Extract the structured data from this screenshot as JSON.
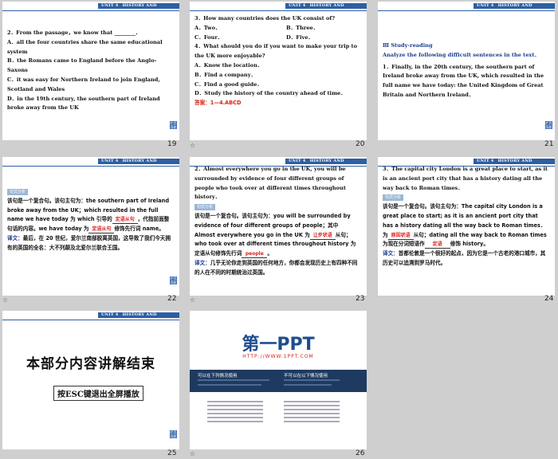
{
  "header": "UNIT 4　HISTORY AND TRADITIONS",
  "corner_label": "栏目导航",
  "s19": {
    "lines": [
      "2．From the passage，we know that ________．",
      "A．all the four countries share the same educational system",
      "B．the Romans came to England before the Anglo-Saxons",
      "C．it was easy for Northern Ireland to join England, Scotland and Wales",
      "D．in the 19th century, the southern part of Ireland broke away from the UK"
    ],
    "num": "19"
  },
  "s20": {
    "q3": "3．How many countries does the UK consist of?",
    "opts1": [
      "A．Two．",
      "B．Three．"
    ],
    "opts2": [
      "C．Four．",
      "D．Five．"
    ],
    "q4": "4．What should you do if you want to make your trip to the UK more enjoyable?",
    "a": "A．Know the location．",
    "b": "B．Find a company．",
    "c": "C．Find a good guide．",
    "d": "D．Study the history of the country ahead of time．",
    "answer": "答案：1—4.ABCD",
    "num": "20"
  },
  "s21": {
    "title": "Ⅲ Study-reading",
    "subtitle": "Analyze the following difficult sentences in the text．",
    "text": "1．Finally, in the 20th century, the southern part of Ireland broke away from the UK, which resulted in the full name we have today: the United Kingdom of Great Britain and Northern Ireland．",
    "num": "21"
  },
  "s22": {
    "tag": "句式分析",
    "p1": "该句是一个复合句。该句主句为：the southern part of Ireland broke away from the UK；which resulted in the full name we have today 为 which 引导的",
    "fill1": "定语从句",
    "p1b": "，代指前面整句话的内容。we have today 为",
    "fill2": "定语从句",
    "p1c": "修饰先行词 name。",
    "trans_label": "译文：",
    "trans": "最后，在 20 世纪，爱尔兰南部脱离英国，这导致了我们今天拥有的英国的全名：大不列颠及北爱尔兰联合王国。",
    "num": "22"
  },
  "s23": {
    "text": "2．Almost everywhere you go in the UK, you will be surrounded by evidence of four different groups of people who took over at different times throughout history．",
    "tag": "句式分析",
    "p1": "该句是一个复合句。该句主句为：you will be surrounded by evidence of four different groups of people；其中 Almost everywhere you go in the UK 为",
    "fill1": "让步状语",
    "p1b": "从句；who took over at different times throughout history 为定语从句修饰先行词",
    "fill2": "people",
    "p1c": "。",
    "trans_label": "译文：",
    "trans": "几乎无论你走到英国的任何地方，你都会发现历史上有四种不同的人在不同的时期统治过英国。",
    "num": "23"
  },
  "s24": {
    "text": "3．The capital city London is a great place to start, as it is an ancient port city that has a history dating all the way back to Roman times．",
    "tag": "句式分析",
    "p1": "该句是一个复合句。该句主句为：The capital city London is a great place to start; as it is an ancient port city that has a history dating all the way back to Roman times．为",
    "fill1": "原因状语",
    "p1b": "从句；dating all the way back to Roman times 为现在分词短语作",
    "fill2": "定语",
    "p1c": "修饰 history。",
    "trans_label": "译文：",
    "trans": "首都伦敦是一个很好的起点，因为它是一个古老的港口城市，其历史可以追溯到罗马时代。",
    "num": "24"
  },
  "s25": {
    "title": "本部分内容讲解结束",
    "button": "按ESC键退出全屏播放",
    "num": "25"
  },
  "s26": {
    "logo": "第一PPT",
    "url": "HTTP://WWW.1PPT.COM",
    "col1_title": "可以在下列情况使用",
    "col2_title": "不可以在以下情况使用",
    "num": "26"
  },
  "star": "☆"
}
